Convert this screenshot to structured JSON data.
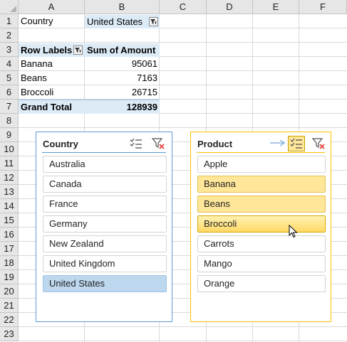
{
  "columns": [
    "A",
    "B",
    "C",
    "D",
    "E",
    "F"
  ],
  "rows": [
    "1",
    "2",
    "3",
    "4",
    "5",
    "6",
    "7",
    "8",
    "9",
    "10",
    "11",
    "12",
    "13",
    "14",
    "15",
    "16",
    "17",
    "18",
    "19",
    "20",
    "21",
    "22",
    "23"
  ],
  "filter": {
    "label": "Country",
    "value": "United States"
  },
  "pivot": {
    "header_labels": "Row Labels",
    "header_values": "Sum of Amount",
    "rows": [
      {
        "label": "Banana",
        "value": "95061"
      },
      {
        "label": "Beans",
        "value": "7163"
      },
      {
        "label": "Broccoli",
        "value": "26715"
      }
    ],
    "total_label": "Grand Total",
    "total_value": "128939"
  },
  "slicer_country": {
    "title": "Country",
    "items": [
      "Australia",
      "Canada",
      "France",
      "Germany",
      "New Zealand",
      "United Kingdom",
      "United States"
    ],
    "selected": [
      "United States"
    ],
    "accent": "#5b9bd5",
    "selected_color": "#bdd7ee"
  },
  "slicer_product": {
    "title": "Product",
    "items": [
      "Apple",
      "Banana",
      "Beans",
      "Broccoli",
      "Carrots",
      "Mango",
      "Orange"
    ],
    "selected": [
      "Banana",
      "Beans",
      "Broccoli"
    ],
    "accent": "#ffc000",
    "selected_color": "#ffe699"
  },
  "icons": [
    "multi-select-icon",
    "clear-filter-icon",
    "filter-dropdown-icon",
    "filter-active-icon",
    "mouse-cursor-icon",
    "arrow-icon"
  ]
}
